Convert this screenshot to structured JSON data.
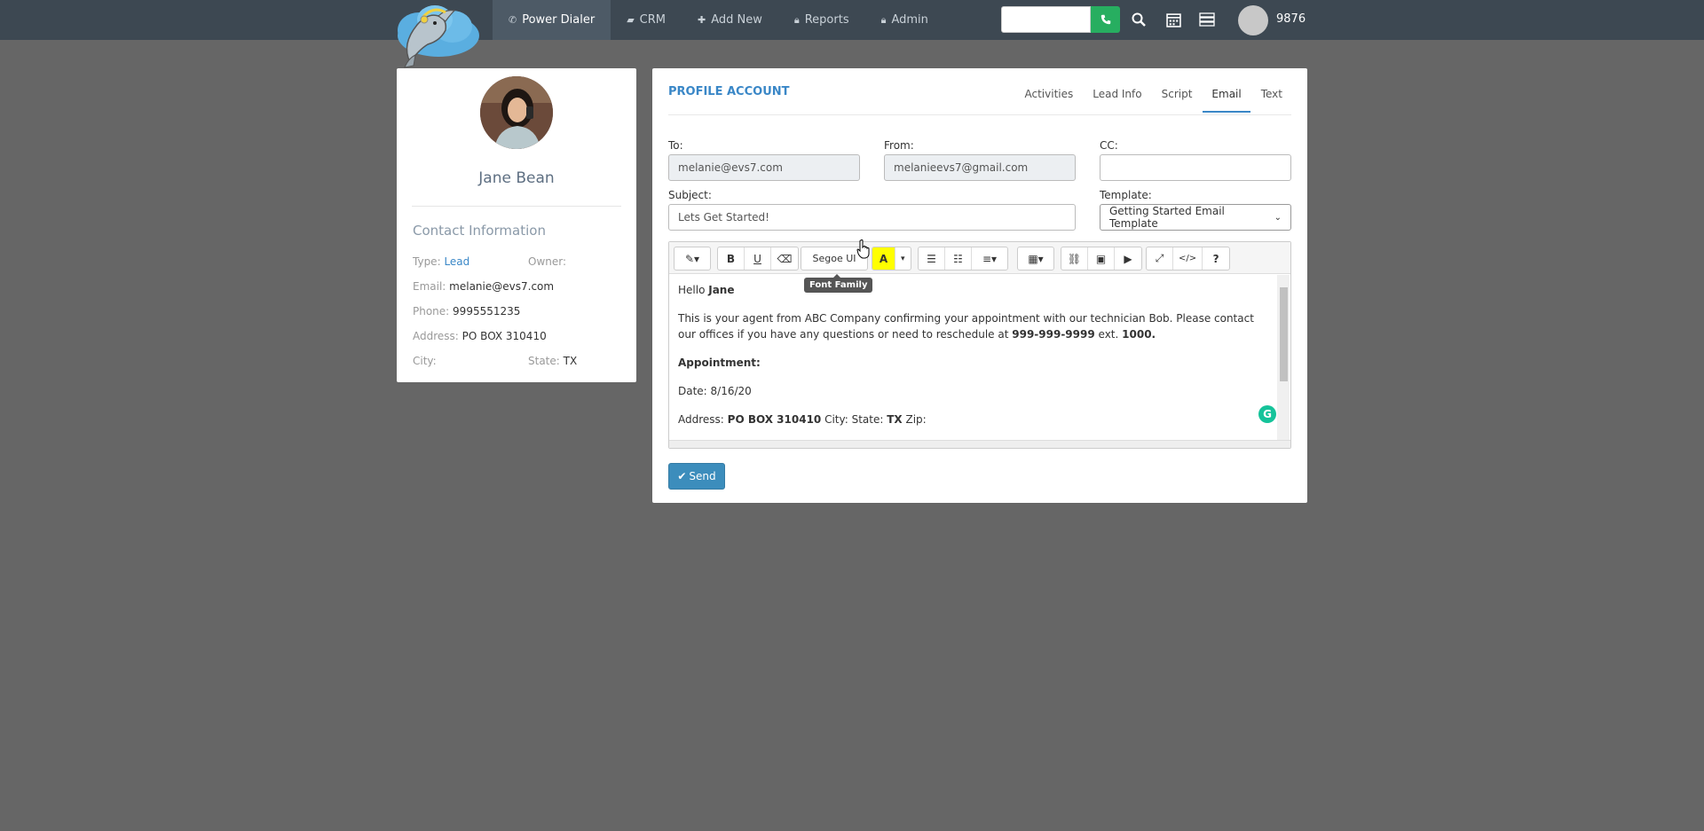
{
  "nav": {
    "items": [
      {
        "label": "Power Dialer",
        "icon": "phone-icon",
        "active": true
      },
      {
        "label": "CRM",
        "icon": "book-icon",
        "active": false
      },
      {
        "label": "Add New",
        "icon": "plus-icon",
        "active": false
      },
      {
        "label": "Reports",
        "icon": "lock-icon",
        "active": false
      },
      {
        "label": "Admin",
        "icon": "lock-icon",
        "active": false
      }
    ],
    "extension": "9876",
    "dial_color": "#27ae60"
  },
  "profile": {
    "name": "Jane Bean",
    "contact_heading": "Contact Information",
    "type_label": "Type:",
    "type_value": "Lead",
    "owner_label": "Owner:",
    "email_label": "Email:",
    "email_value": "melanie@evs7.com",
    "phone_label": "Phone:",
    "phone_value": "9995551235",
    "address_label": "Address:",
    "address_value": "PO BOX 310410",
    "city_label": "City:",
    "state_label": "State:",
    "state_value": "TX"
  },
  "email": {
    "title": "PROFILE ACCOUNT",
    "tabs": [
      "Activities",
      "Lead Info",
      "Script",
      "Email",
      "Text"
    ],
    "active_tab": "Email",
    "to_label": "To:",
    "to_value": "melanie@evs7.com",
    "from_label": "From:",
    "from_value": "melanieevs7@gmail.com",
    "cc_label": "CC:",
    "cc_value": "",
    "subject_label": "Subject:",
    "subject_value": "Lets Get Started!",
    "template_label": "Template:",
    "template_value": "Getting Started Email Template",
    "font_value": "Segoe UI",
    "tooltip": "Font Family",
    "body": {
      "greeting_prefix": "Hello ",
      "greeting_name": "Jane",
      "para1_a": "This is your agent from ABC Company confirming your appointment with our technician Bob. Please contact our offices if you have any questions or need to reschedule at ",
      "para1_phone": "999-999-9999",
      "para1_b": " ext. ",
      "para1_ext": "1000.",
      "appointment_heading": "Appointment:",
      "date_line": "Date: 8/16/20",
      "address_prefix": "Address: ",
      "address_value": "PO BOX 310410",
      "city_state": " City: State: ",
      "state_value": "TX",
      "zip_label": " Zip:"
    },
    "send_label": "Send"
  }
}
